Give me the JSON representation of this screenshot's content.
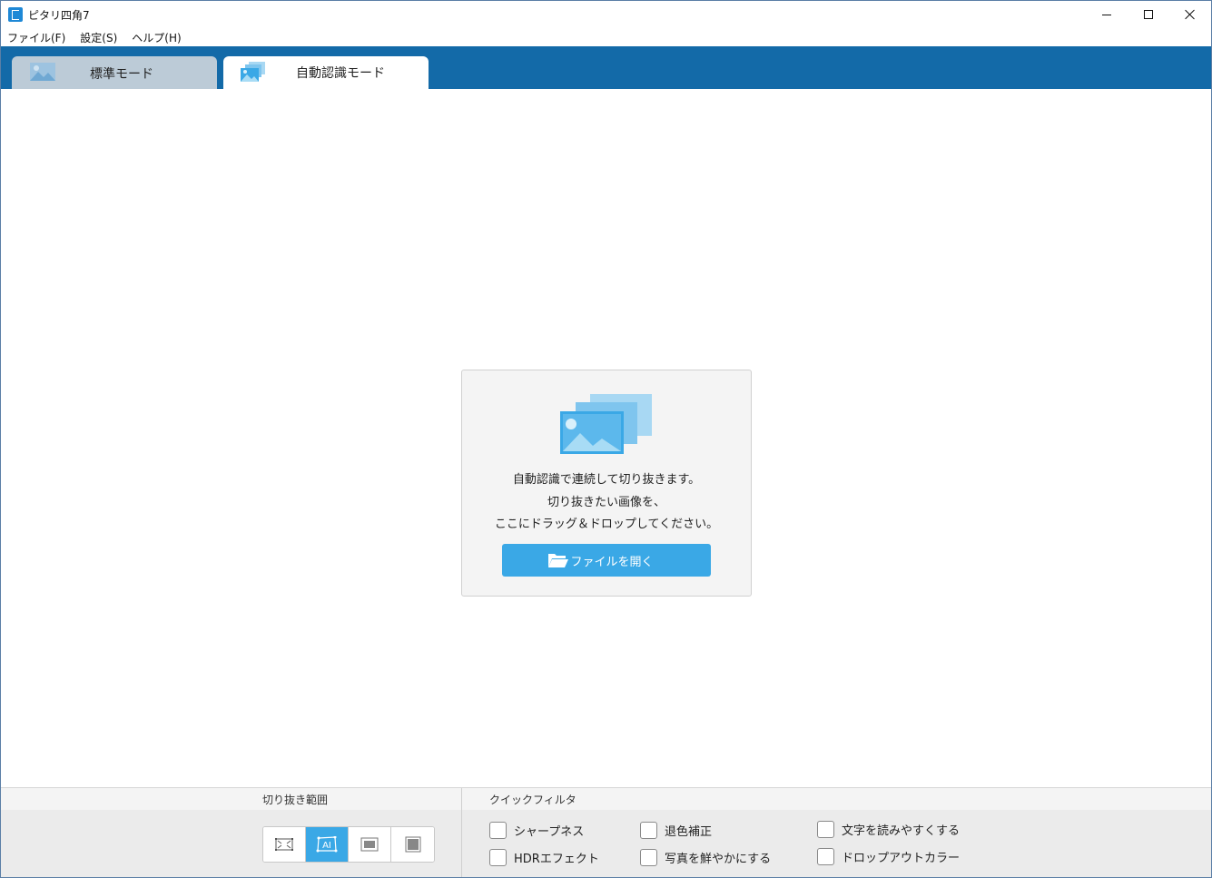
{
  "window": {
    "title": "ピタリ四角7"
  },
  "menu": {
    "items": [
      "ファイル(F)",
      "設定(S)",
      "ヘルプ(H)"
    ]
  },
  "tabs": [
    {
      "label": "標準モード",
      "icon": "image-icon",
      "active": false
    },
    {
      "label": "自動認識モード",
      "icon": "stacked-images-icon",
      "active": true
    }
  ],
  "dropzone": {
    "line1": "自動認識で連続して切り抜きます。",
    "line2": "切り抜きたい画像を、",
    "line3": "ここにドラッグ＆ドロップしてください。",
    "open_button": "ファイルを開く",
    "icon": "stacked-images-icon"
  },
  "crop_panel": {
    "title": "切り抜き範囲",
    "modes": [
      {
        "name": "full-frame",
        "icon": "frame-corners-icon",
        "selected": false
      },
      {
        "name": "ai-detect",
        "icon": "ai-frame-icon",
        "label": "AI",
        "selected": true
      },
      {
        "name": "inner-rect",
        "icon": "inner-rect-icon",
        "selected": false
      },
      {
        "name": "filled-rect",
        "icon": "filled-rect-icon",
        "selected": false
      }
    ]
  },
  "filter_panel": {
    "title": "クイックフィルタ",
    "filters": [
      {
        "label": "シャープネス",
        "checked": false
      },
      {
        "label": "退色補正",
        "checked": false
      },
      {
        "label": "文字を読みやすくする",
        "checked": false
      },
      {
        "label": "HDRエフェクト",
        "checked": false
      },
      {
        "label": "写真を鮮やかにする",
        "checked": false
      },
      {
        "label": "ドロップアウトカラー",
        "checked": false
      }
    ]
  },
  "colors": {
    "accent": "#3aa8e6",
    "tabbar": "#136aa8",
    "inactive_tab": "#bccbd7"
  }
}
